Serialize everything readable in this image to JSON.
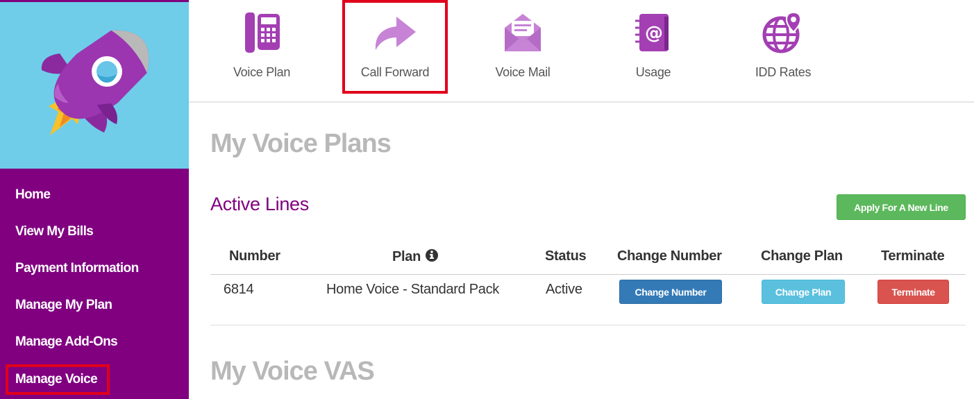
{
  "sidebar": {
    "logo_icon": "rocket-icon",
    "items": [
      {
        "label": "Home"
      },
      {
        "label": "View My Bills"
      },
      {
        "label": "Payment Information"
      },
      {
        "label": "Manage My Plan"
      },
      {
        "label": "Manage Add-Ons"
      },
      {
        "label": "Manage Voice",
        "highlighted": true
      }
    ],
    "colors": {
      "background": "#800080",
      "brand_background": "#6fcde9",
      "highlight": "#e0001b"
    }
  },
  "toolbar": {
    "items": [
      {
        "label": "Voice Plan",
        "icon": "phone-icon"
      },
      {
        "label": "Call Forward",
        "icon": "forward-arrow-icon",
        "highlighted": true
      },
      {
        "label": "Voice Mail",
        "icon": "envelope-icon"
      },
      {
        "label": "Usage",
        "icon": "address-book-icon"
      },
      {
        "label": "IDD Rates",
        "icon": "globe-pin-icon"
      }
    ],
    "icon_color": "#a33fb3"
  },
  "main": {
    "page_title": "My Voice Plans",
    "active_lines": {
      "title": "Active Lines",
      "apply_button": "Apply For A New Line",
      "columns": [
        "Number",
        "Plan",
        "Status",
        "Change Number",
        "Change Plan",
        "Terminate"
      ],
      "plan_info_icon": "info-icon",
      "rows": [
        {
          "number": "6814",
          "plan": "Home Voice - Standard Pack",
          "status": "Active",
          "change_number_button": "Change Number",
          "change_plan_button": "Change Plan",
          "terminate_button": "Terminate"
        }
      ]
    },
    "vas_title": "My Voice VAS"
  }
}
